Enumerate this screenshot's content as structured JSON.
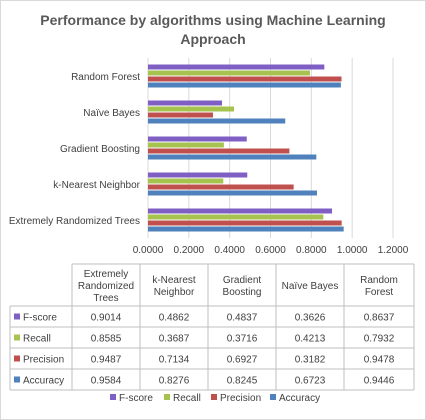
{
  "chart_data": {
    "type": "bar",
    "orientation": "horizontal",
    "title": "Performance by algorithms using Machine Learning Approach",
    "title_lines": [
      "Performance by algorithms using Machine Learning",
      "Approach"
    ],
    "categories": [
      "Extremely Randomized Trees",
      "k-Nearest Neighbor",
      "Gradient Boosting",
      "Naïve Bayes",
      "Random Forest"
    ],
    "table_headers": [
      [
        "Extremely",
        "Randomized",
        "Trees"
      ],
      [
        "k-Nearest",
        "Neighbor"
      ],
      [
        "Gradient",
        "Boosting"
      ],
      [
        "Naïve Bayes"
      ],
      [
        "Random",
        "Forest"
      ]
    ],
    "series": [
      {
        "name": "F-score",
        "color": "#7f5fc4",
        "values": [
          0.9014,
          0.4862,
          0.4837,
          0.3626,
          0.8637
        ],
        "display": [
          "0.9014",
          "0.4862",
          "0.4837",
          "0.3626",
          "0.8637"
        ]
      },
      {
        "name": "Recall",
        "color": "#a6c34f",
        "values": [
          0.8585,
          0.3687,
          0.3716,
          0.4213,
          0.7932
        ],
        "display": [
          "0.8585",
          "0.3687",
          "0.3716",
          "0.4213",
          "0.7932"
        ]
      },
      {
        "name": "Precision",
        "color": "#c0504d",
        "values": [
          0.9487,
          0.7134,
          0.6927,
          0.3182,
          0.9478
        ],
        "display": [
          "0.9487",
          "0.7134",
          "0.6927",
          "0.3182",
          "0.9478"
        ]
      },
      {
        "name": "Accuracy",
        "color": "#4f81bd",
        "values": [
          0.9584,
          0.8276,
          0.8245,
          0.6723,
          0.9446
        ],
        "display": [
          "0.9584",
          "0.8276",
          "0.8245",
          "0.6723",
          "0.9446"
        ]
      }
    ],
    "xlim": [
      0,
      1.2
    ],
    "xticks": [
      "0.0000",
      "0.2000",
      "0.4000",
      "0.6000",
      "0.8000",
      "1.0000",
      "1.2000"
    ],
    "grid": true,
    "legend_position": "bottom",
    "data_table": true
  }
}
